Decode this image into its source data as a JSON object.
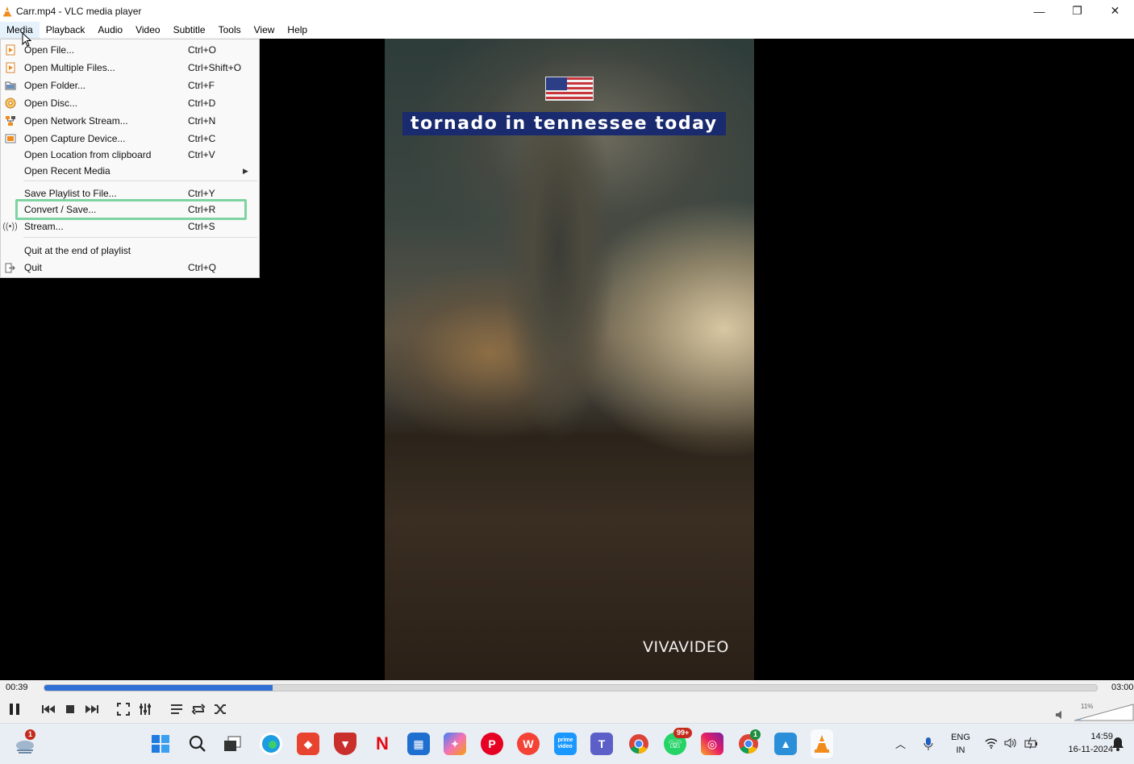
{
  "window": {
    "title": "Carr.mp4 - VLC media player",
    "minimize": "—",
    "restore": "❐",
    "close": "✕"
  },
  "menubar": [
    "Media",
    "Playback",
    "Audio",
    "Video",
    "Subtitle",
    "Tools",
    "View",
    "Help"
  ],
  "media_menu": {
    "items": [
      {
        "label": "Open File...",
        "shortcut": "Ctrl+O",
        "icon": "file-icon"
      },
      {
        "label": "Open Multiple Files...",
        "shortcut": "Ctrl+Shift+O",
        "icon": "files-icon"
      },
      {
        "label": "Open Folder...",
        "shortcut": "Ctrl+F",
        "icon": "folder-icon"
      },
      {
        "label": "Open Disc...",
        "shortcut": "Ctrl+D",
        "icon": "disc-icon"
      },
      {
        "label": "Open Network Stream...",
        "shortcut": "Ctrl+N",
        "icon": "network-icon"
      },
      {
        "label": "Open Capture Device...",
        "shortcut": "Ctrl+C",
        "icon": "capture-icon"
      },
      {
        "label": "Open Location from clipboard",
        "shortcut": "Ctrl+V",
        "icon": ""
      },
      {
        "label": "Open Recent Media",
        "shortcut": "",
        "icon": "",
        "submenu": true
      },
      {
        "label": "Save Playlist to File...",
        "shortcut": "Ctrl+Y",
        "icon": ""
      },
      {
        "label": "Convert / Save...",
        "shortcut": "Ctrl+R",
        "icon": ""
      },
      {
        "label": "Stream...",
        "shortcut": "Ctrl+S",
        "icon": "stream-icon"
      },
      {
        "label": "Quit at the end of playlist",
        "shortcut": "",
        "icon": ""
      },
      {
        "label": "Quit",
        "shortcut": "Ctrl+Q",
        "icon": "quit-icon"
      }
    ]
  },
  "video": {
    "caption": "tornado in tennessee today",
    "watermark": "VIVAVIDEO"
  },
  "player": {
    "elapsed": "00:39",
    "total": "03:00",
    "progress": 0.217,
    "volume_label": "11%",
    "volume": 0.11
  },
  "taskbar": {
    "weather_badge": "1",
    "whatsapp_badge": "99+",
    "chrome_badge": "1",
    "lang_primary": "ENG",
    "lang_secondary": "IN",
    "time": "14:59",
    "date": "16-11-2024"
  },
  "colors": {
    "highlight": "#7ed3a2",
    "seek_fill": "#2f6fd6",
    "vlc_orange": "#f18c1c"
  }
}
